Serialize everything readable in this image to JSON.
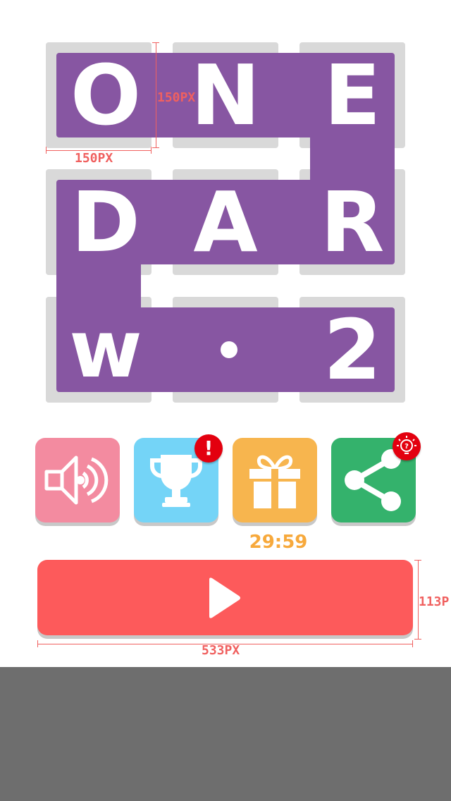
{
  "logo": {
    "letters": [
      "O",
      "N",
      "E",
      "D",
      "A",
      "R",
      "w",
      "2"
    ],
    "dot": "•"
  },
  "annotations": {
    "tile_width": "150PX",
    "tile_height": "150PX",
    "play_width": "533PX",
    "play_height": "113P"
  },
  "buttons": {
    "sound": {
      "icon": "speaker-icon",
      "color": "#f38ba0"
    },
    "leaderboard": {
      "icon": "trophy-icon",
      "color": "#74d4f7",
      "badge": "!"
    },
    "gift": {
      "icon": "gift-icon",
      "color": "#f7b54e",
      "timer": "29:59"
    },
    "share": {
      "icon": "share-icon",
      "color": "#34b26c",
      "badge_icon": "lightbulb-question-icon"
    }
  },
  "play_button": {
    "icon": "play-icon",
    "color": "#fd5a5b"
  },
  "colors": {
    "tile": "#d9d9d9",
    "band": "#8756a2",
    "annotation": "#f0605f",
    "badge": "#e3000f",
    "footer": "#6e6e6e"
  }
}
